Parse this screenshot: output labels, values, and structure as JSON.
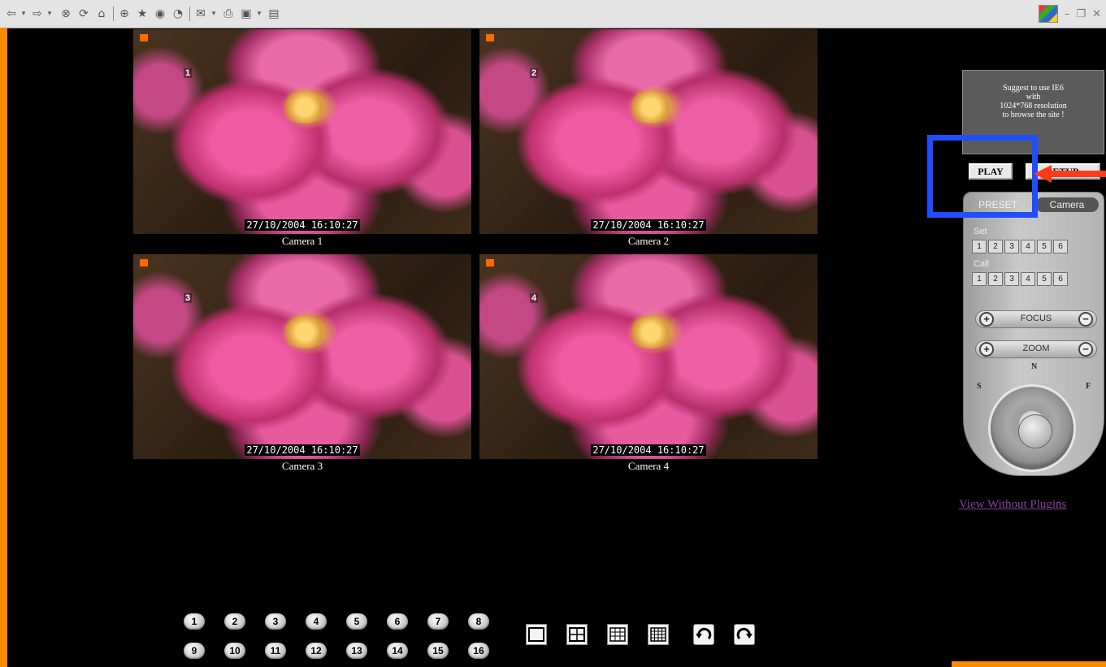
{
  "toolbar": {
    "icons": [
      "back-arrow-icon",
      "forward-arrow-icon",
      "stop-icon",
      "refresh-icon",
      "home-icon",
      "search-icon",
      "favorites-icon",
      "media-icon",
      "history-icon",
      "mail-icon",
      "print-icon",
      "edit-icon",
      "discuss-icon"
    ],
    "window_controls": [
      "minimize",
      "restore",
      "close"
    ]
  },
  "cameras": [
    {
      "number": "1",
      "timestamp": "27/10/2004 16:10:27",
      "label": "Camera 1"
    },
    {
      "number": "2",
      "timestamp": "27/10/2004 16:10:27",
      "label": "Camera 2"
    },
    {
      "number": "3",
      "timestamp": "27/10/2004 16:10:27",
      "label": "Camera 3"
    },
    {
      "number": "4",
      "timestamp": "27/10/2004 16:10:27",
      "label": "Camera 4"
    }
  ],
  "notice": {
    "line1": "Suggest to use IE6",
    "line2": "with",
    "line3": "1024*768 resolution",
    "line4": "to browse the site !"
  },
  "buttons": {
    "play": "PLAY",
    "setup": "SETUP"
  },
  "ptz": {
    "tab_preset": "PRESET",
    "tab_camera": "Camera",
    "set_label": "Set",
    "call_label": "Call",
    "set_buttons": [
      "1",
      "2",
      "3",
      "4",
      "5",
      "6"
    ],
    "call_buttons": [
      "1",
      "2",
      "3",
      "4",
      "5",
      "6"
    ],
    "focus_label": "FOCUS",
    "zoom_label": "ZOOM",
    "plus": "+",
    "minus": "−",
    "compass_n": "N",
    "compass_s": "S",
    "compass_f": "F"
  },
  "view_without_plugins": "View Without Plugins",
  "channels": [
    "1",
    "2",
    "3",
    "4",
    "5",
    "6",
    "7",
    "8",
    "9",
    "10",
    "11",
    "12",
    "13",
    "14",
    "15",
    "16"
  ],
  "layouts": [
    "single-view-icon",
    "quad-view-icon",
    "nine-view-icon",
    "sixteen-view-icon",
    "rotate-left-icon",
    "rotate-right-icon"
  ],
  "colors": {
    "accent": "#ff8a00",
    "highlight_box": "#1f4dff",
    "arrow": "#ff3b1a"
  }
}
